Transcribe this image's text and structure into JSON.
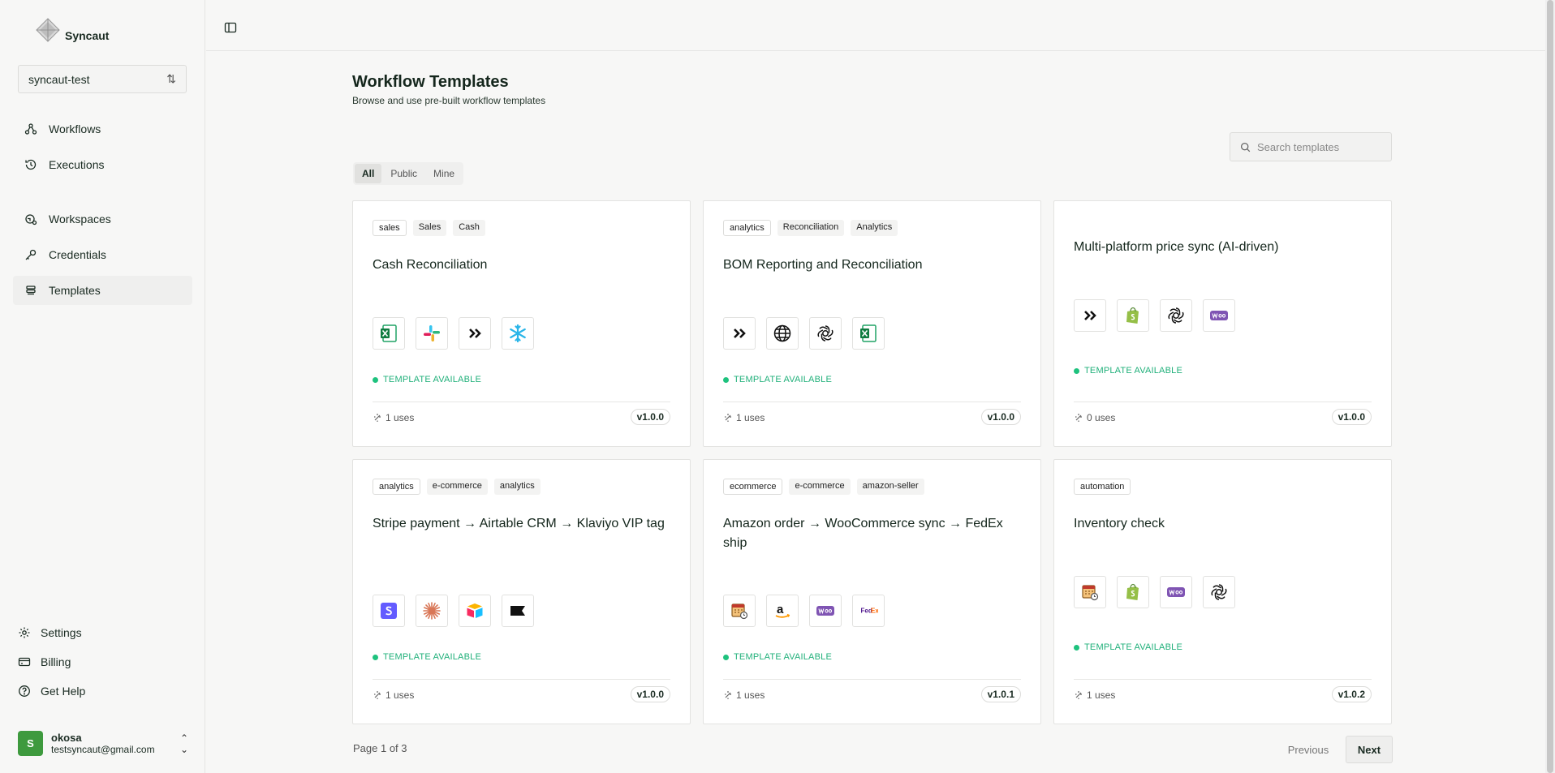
{
  "brand": {
    "name": "Syncaut"
  },
  "workspace": {
    "name": "syncaut-test"
  },
  "nav": {
    "primary": [
      {
        "label": "Workflows",
        "icon": "workflow-icon"
      },
      {
        "label": "Executions",
        "icon": "history-icon"
      }
    ],
    "secondary": [
      {
        "label": "Workspaces",
        "icon": "workspace-icon"
      },
      {
        "label": "Credentials",
        "icon": "key-icon"
      },
      {
        "label": "Templates",
        "icon": "template-icon",
        "active": true
      }
    ],
    "bottom": [
      {
        "label": "Settings",
        "icon": "gear-icon"
      },
      {
        "label": "Billing",
        "icon": "credit-card-icon"
      },
      {
        "label": "Get Help",
        "icon": "help-icon"
      }
    ]
  },
  "user": {
    "initial": "S",
    "name": "okosa",
    "email": "testsyncaut@gmail.com"
  },
  "page": {
    "title": "Workflow Templates",
    "subtitle": "Browse and use pre-built workflow templates",
    "search_placeholder": "Search templates",
    "filters": [
      {
        "label": "All",
        "active": true
      },
      {
        "label": "Public"
      },
      {
        "label": "Mine"
      }
    ]
  },
  "templates": [
    {
      "tags": [
        "sales",
        "Sales",
        "Cash"
      ],
      "title": "Cash Reconciliation",
      "apps": [
        "excel-icon",
        "slack-icon",
        "chevrons-icon",
        "snowflake-icon"
      ],
      "status": "TEMPLATE AVAILABLE",
      "uses": "1 uses",
      "version": "v1.0.0"
    },
    {
      "tags": [
        "analytics",
        "Reconciliation",
        "Analytics"
      ],
      "title": "BOM Reporting and Reconciliation",
      "apps": [
        "chevrons-icon",
        "globe-icon",
        "openai-icon",
        "excel-icon"
      ],
      "status": "TEMPLATE AVAILABLE",
      "uses": "1 uses",
      "version": "v1.0.0"
    },
    {
      "tags": [],
      "title": "Multi-platform price sync (AI-driven)",
      "apps": [
        "chevrons-icon",
        "shopify-icon",
        "openai-icon",
        "woocommerce-icon"
      ],
      "status": "TEMPLATE AVAILABLE",
      "uses": "0 uses",
      "version": "v1.0.0"
    },
    {
      "tags": [
        "analytics",
        "e-commerce",
        "analytics"
      ],
      "title": "Stripe payment → Airtable CRM → Klaviyo VIP tag",
      "apps": [
        "stripe-icon",
        "claude-icon",
        "airtable-icon",
        "klaviyo-icon"
      ],
      "status": "TEMPLATE AVAILABLE",
      "uses": "1 uses",
      "version": "v1.0.0"
    },
    {
      "tags": [
        "ecommerce",
        "e-commerce",
        "amazon-seller"
      ],
      "title": "Amazon order → WooCommerce sync → FedEx ship",
      "apps": [
        "schedule-icon",
        "amazon-icon",
        "woocommerce-icon",
        "fedex-icon"
      ],
      "status": "TEMPLATE AVAILABLE",
      "uses": "1 uses",
      "version": "v1.0.1"
    },
    {
      "tags": [
        "automation"
      ],
      "title": "Inventory check",
      "apps": [
        "schedule-icon",
        "shopify-icon",
        "woocommerce-icon",
        "openai-icon"
      ],
      "status": "TEMPLATE AVAILABLE",
      "uses": "1 uses",
      "version": "v1.0.2"
    }
  ],
  "pagination": {
    "text": "Page 1 of 3",
    "previous": "Previous",
    "next": "Next"
  },
  "colors": {
    "accent_green": "#1ec27e",
    "avatar": "#3e9a3e"
  }
}
